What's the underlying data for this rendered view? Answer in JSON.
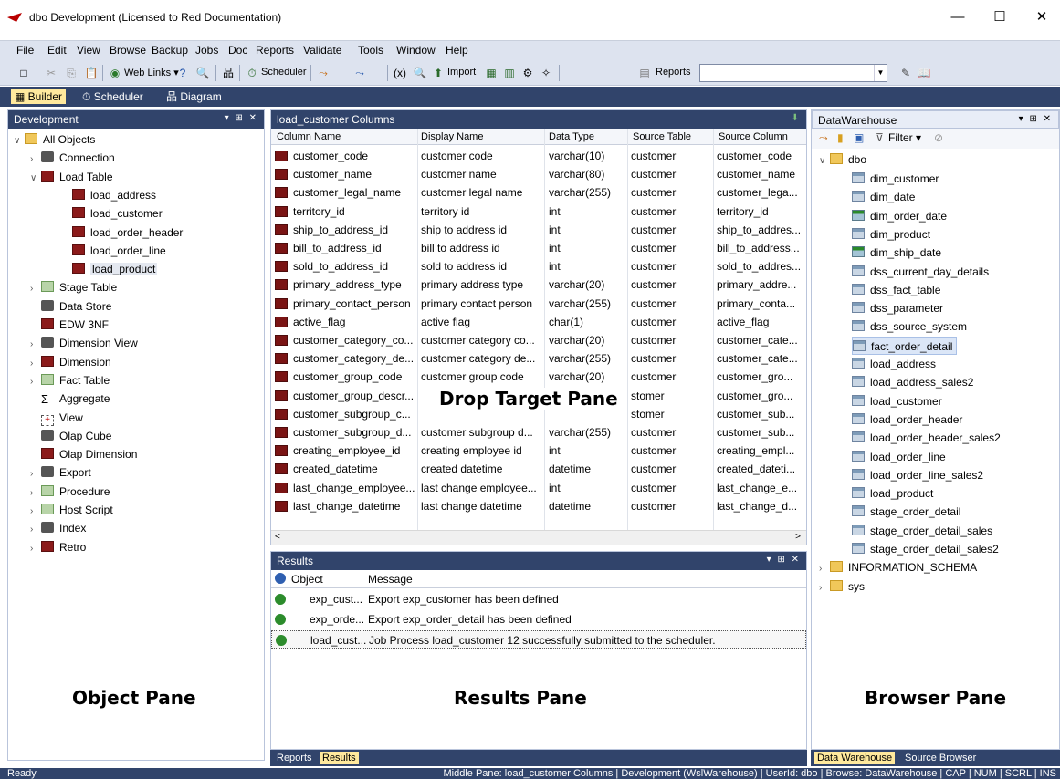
{
  "window": {
    "title": "dbo  Development  (Licensed to Red Documentation)",
    "controls": [
      "—",
      "☐",
      "✕"
    ]
  },
  "menu": [
    "File",
    "Edit",
    "View",
    "Browse",
    "Backup",
    "Jobs",
    "Doc",
    "Reports",
    "Validate",
    "Tools",
    "Window",
    "Help"
  ],
  "toolbar": {
    "web_links": "Web Links",
    "scheduler": "Scheduler",
    "import": "Import",
    "reports": "Reports",
    "reports_combo_value": ""
  },
  "ribbon": {
    "tabs": [
      "Builder",
      "Scheduler",
      "Diagram"
    ]
  },
  "object_pane": {
    "title": "Development",
    "controls": "▾ ⊞ ✕",
    "caption": "Object Pane",
    "tree": [
      {
        "label": "All Objects",
        "icon": "folder-icon",
        "level": 0,
        "expanded": true
      },
      {
        "label": "Connection",
        "icon": "connection-icon",
        "level": 1,
        "expanded": false
      },
      {
        "label": "Load Table",
        "icon": "load-table-icon",
        "level": 1,
        "expanded": true
      },
      {
        "label": "load_address",
        "icon": "load-table-icon",
        "level": 2
      },
      {
        "label": "load_customer",
        "icon": "load-table-icon",
        "level": 2
      },
      {
        "label": "load_order_header",
        "icon": "load-table-icon",
        "level": 2
      },
      {
        "label": "load_order_line",
        "icon": "load-table-icon",
        "level": 2
      },
      {
        "label": "load_product",
        "icon": "load-table-icon",
        "level": 2,
        "selected": true
      },
      {
        "label": "Stage Table",
        "icon": "stage-table-icon",
        "level": 1,
        "expanded": false
      },
      {
        "label": "Data Store",
        "icon": "data-store-icon",
        "level": 1
      },
      {
        "label": "EDW 3NF",
        "icon": "edw-icon",
        "level": 1
      },
      {
        "label": "Dimension View",
        "icon": "dimension-view-icon",
        "level": 1,
        "expanded": false
      },
      {
        "label": "Dimension",
        "icon": "dimension-icon",
        "level": 1,
        "expanded": false
      },
      {
        "label": "Fact Table",
        "icon": "fact-table-icon",
        "level": 1,
        "expanded": false
      },
      {
        "label": "Aggregate",
        "icon": "sigma-icon",
        "level": 1
      },
      {
        "label": "View",
        "icon": "view-icon",
        "level": 1
      },
      {
        "label": "Olap Cube",
        "icon": "olap-cube-icon",
        "level": 1
      },
      {
        "label": "Olap Dimension",
        "icon": "olap-dimension-icon",
        "level": 1
      },
      {
        "label": "Export",
        "icon": "export-icon",
        "level": 1,
        "expanded": false
      },
      {
        "label": "Procedure",
        "icon": "procedure-icon",
        "level": 1,
        "expanded": false
      },
      {
        "label": "Host Script",
        "icon": "host-script-icon",
        "level": 1,
        "expanded": false
      },
      {
        "label": "Index",
        "icon": "index-icon",
        "level": 1,
        "expanded": false
      },
      {
        "label": "Retro",
        "icon": "retro-icon",
        "level": 1,
        "expanded": false
      }
    ]
  },
  "columns_pane": {
    "title": "load_customer Columns",
    "caption": "Drop Target Pane",
    "headers": [
      "Column Name",
      "Display Name",
      "Data Type",
      "Source Table",
      "Source Column"
    ],
    "rows": [
      [
        "customer_code",
        "customer code",
        "varchar(10)",
        "customer",
        "customer_code"
      ],
      [
        "customer_name",
        "customer name",
        "varchar(80)",
        "customer",
        "customer_name"
      ],
      [
        "customer_legal_name",
        "customer legal name",
        "varchar(255)",
        "customer",
        "customer_lega..."
      ],
      [
        "territory_id",
        "territory id",
        "int",
        "customer",
        "territory_id"
      ],
      [
        "ship_to_address_id",
        "ship to address id",
        "int",
        "customer",
        "ship_to_addres..."
      ],
      [
        "bill_to_address_id",
        "bill to address id",
        "int",
        "customer",
        "bill_to_address..."
      ],
      [
        "sold_to_address_id",
        "sold to address id",
        "int",
        "customer",
        "sold_to_addres..."
      ],
      [
        "primary_address_type",
        "primary address type",
        "varchar(20)",
        "customer",
        "primary_addre..."
      ],
      [
        "primary_contact_person",
        "primary contact person",
        "varchar(255)",
        "customer",
        "primary_conta..."
      ],
      [
        "active_flag",
        "active flag",
        "char(1)",
        "customer",
        "active_flag"
      ],
      [
        "customer_category_co...",
        "customer category co...",
        "varchar(20)",
        "customer",
        "customer_cate..."
      ],
      [
        "customer_category_de...",
        "customer category de...",
        "varchar(255)",
        "customer",
        "customer_cate..."
      ],
      [
        "customer_group_code",
        "customer group code",
        "varchar(20)",
        "customer",
        "customer_gro..."
      ],
      [
        "customer_group_descr...",
        "",
        "",
        "stomer",
        "customer_gro..."
      ],
      [
        "customer_subgroup_c...",
        "",
        "",
        "stomer",
        "customer_sub..."
      ],
      [
        "customer_subgroup_d...",
        "customer subgroup d...",
        "varchar(255)",
        "customer",
        "customer_sub..."
      ],
      [
        "creating_employee_id",
        "creating employee id",
        "int",
        "customer",
        "creating_empl..."
      ],
      [
        "created_datetime",
        "created datetime",
        "datetime",
        "customer",
        "created_dateti..."
      ],
      [
        "last_change_employee...",
        "last change employee...",
        "int",
        "customer",
        "last_change_e..."
      ],
      [
        "last_change_datetime",
        "last change datetime",
        "datetime",
        "customer",
        "last_change_d..."
      ]
    ]
  },
  "results_pane": {
    "title": "Results",
    "caption": "Results Pane",
    "headers": [
      "Object",
      "Message"
    ],
    "rows": [
      {
        "object": "exp_cust...",
        "message": "Export exp_customer has been defined"
      },
      {
        "object": "exp_orde...",
        "message": "Export exp_order_detail has been defined"
      },
      {
        "object": "load_cust...",
        "message": "Job Process load_customer 12 successfully submitted to the scheduler."
      }
    ],
    "tabs": [
      "Reports",
      "Results"
    ]
  },
  "browser_pane": {
    "title": "DataWarehouse",
    "filter": "Filter",
    "caption": "Browser Pane",
    "root": "dbo",
    "tables": [
      {
        "label": "dim_customer",
        "kind": "blue"
      },
      {
        "label": "dim_date",
        "kind": "blue"
      },
      {
        "label": "dim_order_date",
        "kind": "green"
      },
      {
        "label": "dim_product",
        "kind": "blue"
      },
      {
        "label": "dim_ship_date",
        "kind": "green"
      },
      {
        "label": "dss_current_day_details",
        "kind": "blue"
      },
      {
        "label": "dss_fact_table",
        "kind": "blue"
      },
      {
        "label": "dss_parameter",
        "kind": "blue"
      },
      {
        "label": "dss_source_system",
        "kind": "blue"
      },
      {
        "label": "fact_order_detail",
        "kind": "blue",
        "selected": true
      },
      {
        "label": "load_address",
        "kind": "blue"
      },
      {
        "label": "load_address_sales2",
        "kind": "blue"
      },
      {
        "label": "load_customer",
        "kind": "blue"
      },
      {
        "label": "load_order_header",
        "kind": "blue"
      },
      {
        "label": "load_order_header_sales2",
        "kind": "blue"
      },
      {
        "label": "load_order_line",
        "kind": "blue"
      },
      {
        "label": "load_order_line_sales2",
        "kind": "blue"
      },
      {
        "label": "load_product",
        "kind": "blue"
      },
      {
        "label": "stage_order_detail",
        "kind": "blue"
      },
      {
        "label": "stage_order_detail_sales",
        "kind": "blue"
      },
      {
        "label": "stage_order_detail_sales2",
        "kind": "blue"
      }
    ],
    "other_roots": [
      "INFORMATION_SCHEMA",
      "sys"
    ],
    "tabs": [
      "Data Warehouse",
      "Source Browser"
    ]
  },
  "status": {
    "left": "Ready",
    "right": "Middle Pane: load_customer Columns | Development (WslWarehouse) | UserId: dbo | Browse: DataWarehouse | CAP | NUM | SCRL | INS"
  }
}
